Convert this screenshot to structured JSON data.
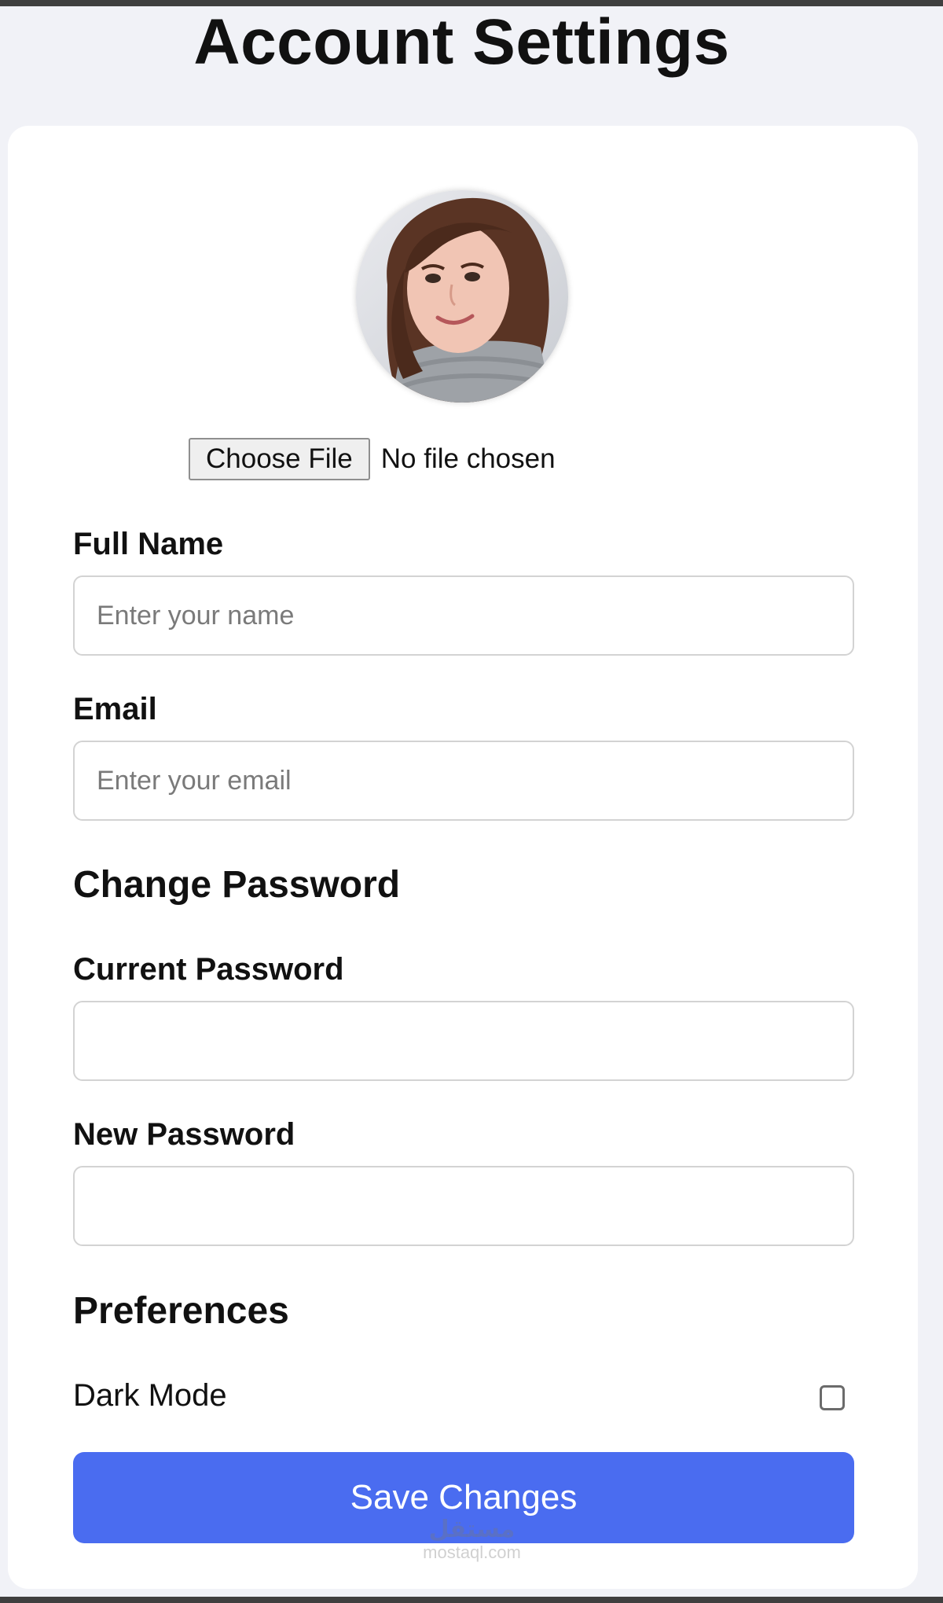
{
  "page": {
    "title": "Account Settings"
  },
  "profile": {
    "file_button_label": "Choose File",
    "file_status": "No file chosen"
  },
  "fields": {
    "full_name": {
      "label": "Full Name",
      "placeholder": "Enter your name",
      "value": ""
    },
    "email": {
      "label": "Email",
      "placeholder": "Enter your email",
      "value": ""
    }
  },
  "password_section": {
    "heading": "Change Password",
    "current": {
      "label": "Current Password",
      "value": ""
    },
    "new": {
      "label": "New Password",
      "value": ""
    }
  },
  "preferences": {
    "heading": "Preferences",
    "dark_mode": {
      "label": "Dark Mode",
      "checked": false
    }
  },
  "actions": {
    "save_label": "Save Changes"
  },
  "watermark": {
    "mark": "مستقل",
    "text": "mostaql.com"
  },
  "colors": {
    "page_background": "#f1f2f7",
    "card_background": "#ffffff",
    "primary_button": "#4a6cf0",
    "input_border": "#d3d3d3"
  },
  "icons": {
    "avatar": "profile-photo"
  }
}
